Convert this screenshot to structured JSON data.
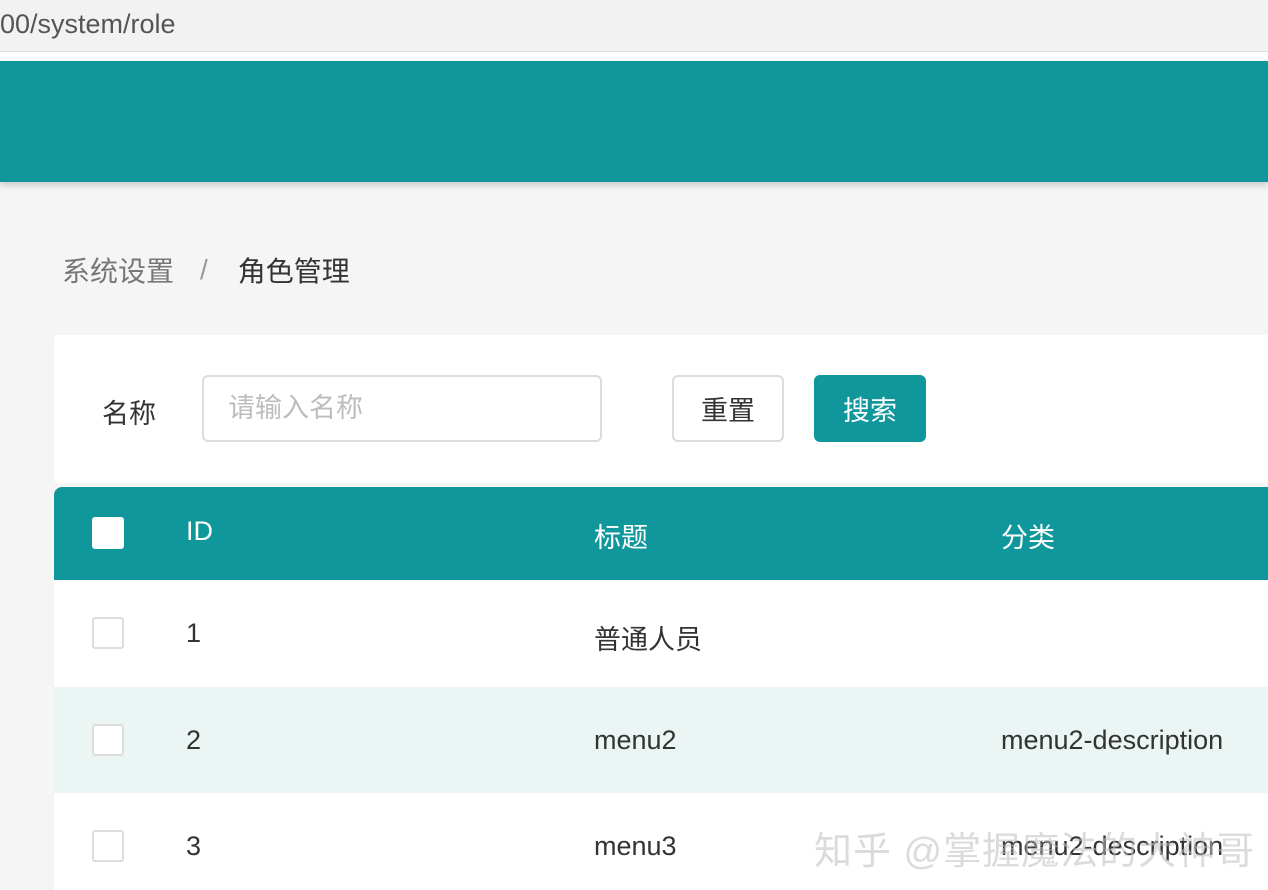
{
  "browser": {
    "url_text": "00/system/role"
  },
  "theme": {
    "primary": "#10979b",
    "row_alt": "#ebf5f4"
  },
  "breadcrumb": {
    "parent": "系统设置",
    "separator": "/",
    "current": "角色管理"
  },
  "search": {
    "label": "名称",
    "input_value": "",
    "input_placeholder": "请输入名称",
    "reset_label": "重置",
    "search_label": "搜索"
  },
  "table": {
    "columns": [
      "ID",
      "标题",
      "分类"
    ],
    "rows": [
      {
        "id": "1",
        "title": "普通人员",
        "category": ""
      },
      {
        "id": "2",
        "title": "menu2",
        "category": "menu2-description"
      },
      {
        "id": "3",
        "title": "menu3",
        "category": "menu2-description"
      }
    ]
  },
  "watermark": "知乎 @掌握魔法的大神哥"
}
